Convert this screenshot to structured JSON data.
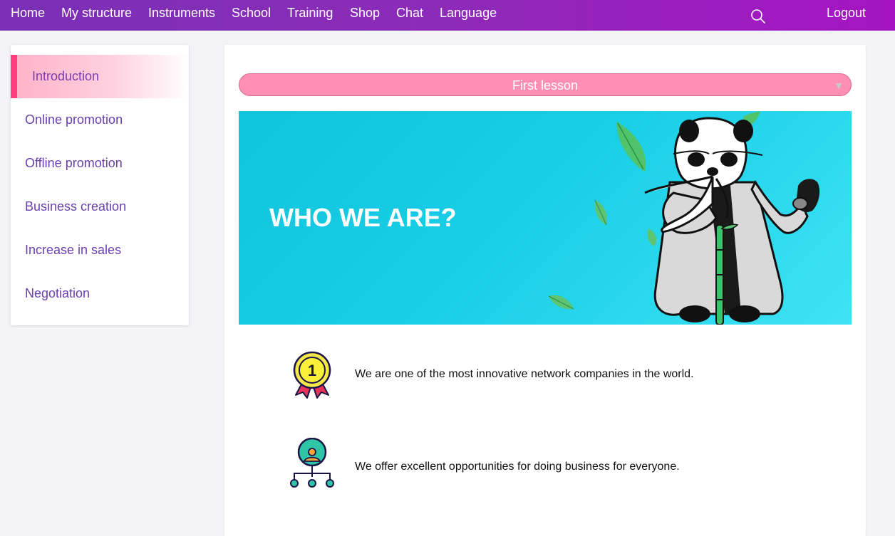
{
  "nav": {
    "home": "Home",
    "my_structure": "My structure",
    "instruments": "Instruments",
    "school": "School",
    "training": "Training",
    "shop": "Shop",
    "chat": "Chat",
    "language": "Language",
    "logout": "Logout",
    "search_icon": "search-icon"
  },
  "sidebar": {
    "items": [
      {
        "label": "Introduction",
        "active": true
      },
      {
        "label": "Online promotion",
        "active": false
      },
      {
        "label": "Offline promotion",
        "active": false
      },
      {
        "label": "Business creation",
        "active": false
      },
      {
        "label": "Increase in sales",
        "active": false
      },
      {
        "label": "Negotiation",
        "active": false
      }
    ]
  },
  "lesson_select": {
    "selected": "First lesson"
  },
  "banner": {
    "title": "WHO WE ARE?"
  },
  "features": [
    {
      "icon": "medal-icon",
      "text": "We are one of the most innovative network companies in the world."
    },
    {
      "icon": "network-icon",
      "text": "We offer excellent opportunities for doing business for everyone."
    }
  ],
  "colors": {
    "nav_gradient_start": "#7a2fb6",
    "nav_gradient_end": "#a514c2",
    "accent_pink": "#ff3d7f",
    "select_pink": "#ff8fb4",
    "banner_cyan": "#18cde6",
    "sidebar_text": "#6a3fae"
  }
}
